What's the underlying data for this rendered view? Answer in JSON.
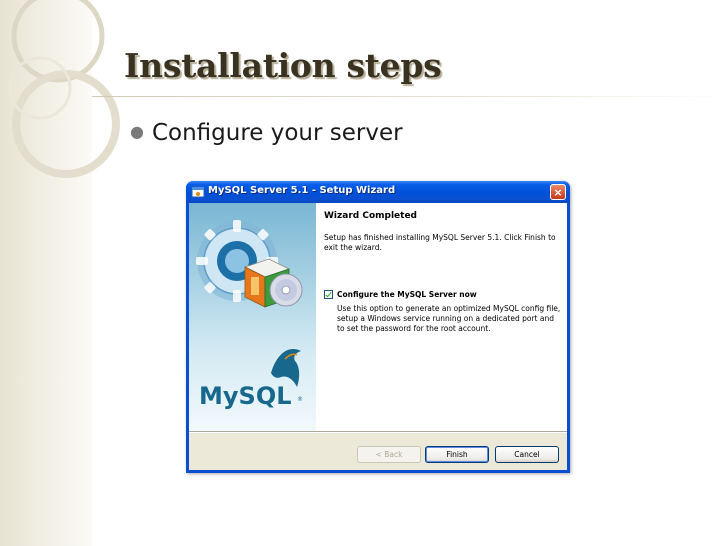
{
  "slide": {
    "title": "Installation steps",
    "bullet": "Configure your server"
  },
  "dialog": {
    "title": "MySQL Server 5.1 - Setup Wizard",
    "close_label": "×",
    "logo_text": "MySQL",
    "heading": "Wizard Completed",
    "message": "Setup has finished installing MySQL Server 5.1. Click Finish to exit the wizard.",
    "checkbox": {
      "label": "Configure the MySQL Server now",
      "checked": true,
      "description": "Use this option to generate an optimized MySQL config file, setup a Windows service running on a dedicated port and to set the password for the root account."
    },
    "buttons": {
      "back": "< Back",
      "finish": "Finish",
      "cancel": "Cancel"
    }
  },
  "colors": {
    "title_text": "#3a3220",
    "titlebar_blue": "#0a4fd1",
    "dialog_face": "#ece9d8",
    "mysql_blue": "#17688c",
    "mysql_orange": "#e4870b"
  },
  "icons": [
    "setup-window-icon",
    "close-icon",
    "gear-icon",
    "package-box-icon",
    "cd-disc-icon",
    "dolphin-icon",
    "checkmark-icon",
    "bullet-icon"
  ]
}
